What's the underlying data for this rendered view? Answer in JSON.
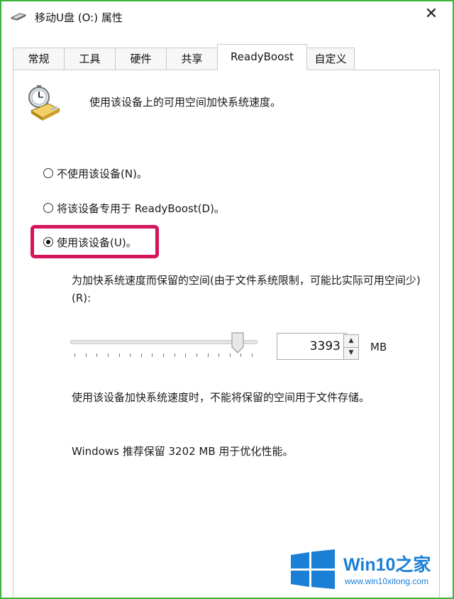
{
  "window": {
    "title": "移动U盘 (O:) 属性",
    "close_glyph": "✕"
  },
  "tabs": [
    {
      "label": "常规"
    },
    {
      "label": "工具"
    },
    {
      "label": "硬件"
    },
    {
      "label": "共享"
    },
    {
      "label": "ReadyBoost",
      "active": true
    },
    {
      "label": "自定义"
    }
  ],
  "readyboost": {
    "intro": "使用该设备上的可用空间加快系统速度。",
    "options": [
      {
        "label": "不使用该设备(N)。",
        "checked": false
      },
      {
        "label": "将该设备专用于 ReadyBoost(D)。",
        "checked": false
      },
      {
        "label": "使用该设备(U)。",
        "checked": true
      }
    ],
    "reserve_label": "为加快系统速度而保留的空间(由于文件系统限制，可能比实际可用空间少)(R):",
    "slider_level": 0.93,
    "reserve_value": "3393",
    "unit": "MB",
    "note": "使用该设备加快系统速度时，不能将保留的空间用于文件存储。",
    "recommendation": "Windows 推荐保留 3202 MB 用于优化性能。"
  },
  "watermark": {
    "brand": "Win10",
    "brand_suffix": "之家",
    "url": "www.win10xitong.com"
  },
  "colors": {
    "highlight": "#d5145c",
    "window_border": "#3cb43c",
    "brand_blue": "#1b7fd6"
  },
  "icons": [
    "drive-icon",
    "close-icon",
    "readyboost-device-icon",
    "spin-up-icon",
    "spin-down-icon",
    "windows-logo-icon"
  ]
}
